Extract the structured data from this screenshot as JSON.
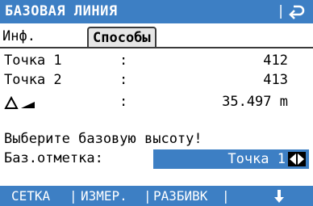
{
  "title": "БАЗОВАЯ ЛИНИЯ",
  "title_separator": "|",
  "tabs": [
    {
      "label": "Инф.",
      "active": false
    },
    {
      "label": "Способы",
      "active": true
    }
  ],
  "rows": [
    {
      "label": "Точка 1",
      "colon": ":",
      "value": "412"
    },
    {
      "label": "Точка 2",
      "colon": ":",
      "value": "413"
    },
    {
      "label": "",
      "colon": ":",
      "value": "35.497 m"
    }
  ],
  "message": "Выберите базовую высоту!",
  "height_label": "Баз.отметка:",
  "height_value": "Точка 1",
  "softkeys": [
    "СЕТКА",
    "ИЗМЕР.",
    "РАЗБИВК"
  ],
  "softkey_separator": "|",
  "colors": {
    "accent": "#3d7fc4",
    "background": "#ffffff",
    "text": "#000000",
    "tab_active_bg": "#e6e6e6"
  },
  "icons": {
    "back": "back-arrow-icon",
    "delta_slope": "delta-slope-icon",
    "arrows": "left-right-arrows-icon",
    "down": "down-arrow-icon"
  }
}
